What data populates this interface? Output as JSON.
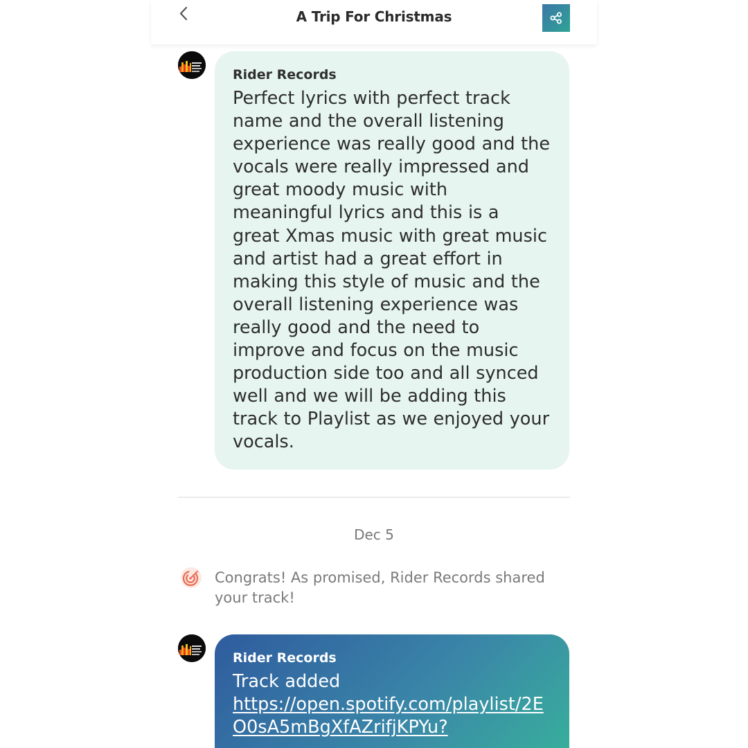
{
  "header": {
    "title": "A Trip For Christmas",
    "back_icon": "chevron-left-icon",
    "share_icon": "share-icon",
    "share_color": "#3a8ea7"
  },
  "messages": [
    {
      "sender": "Rider Records",
      "text": "Perfect lyrics with perfect track name and the overall listening experience was really good and the vocals were really impressed and great moody music with meaningful lyrics and this is a great Xmas music with great music and artist had a great effort in making this style of music and the overall listening experience was really good and the need to improve and focus on the music production side too and all synced well and we will be adding this track to Playlist as we enjoyed your vocals.",
      "bubble_color": "#e6f5ef"
    }
  ],
  "date_separator": "Dec 5",
  "system_message": {
    "icon": "target-icon",
    "icon_color": "#e8735a",
    "text": "Congrats! As promised, Rider Records shared your track!"
  },
  "track_message": {
    "sender": "Rider Records",
    "text": "Track added",
    "link": "https://open.spotify.com/playlist/2EO0sA5mBgXfAZrifjKPYu?"
  }
}
